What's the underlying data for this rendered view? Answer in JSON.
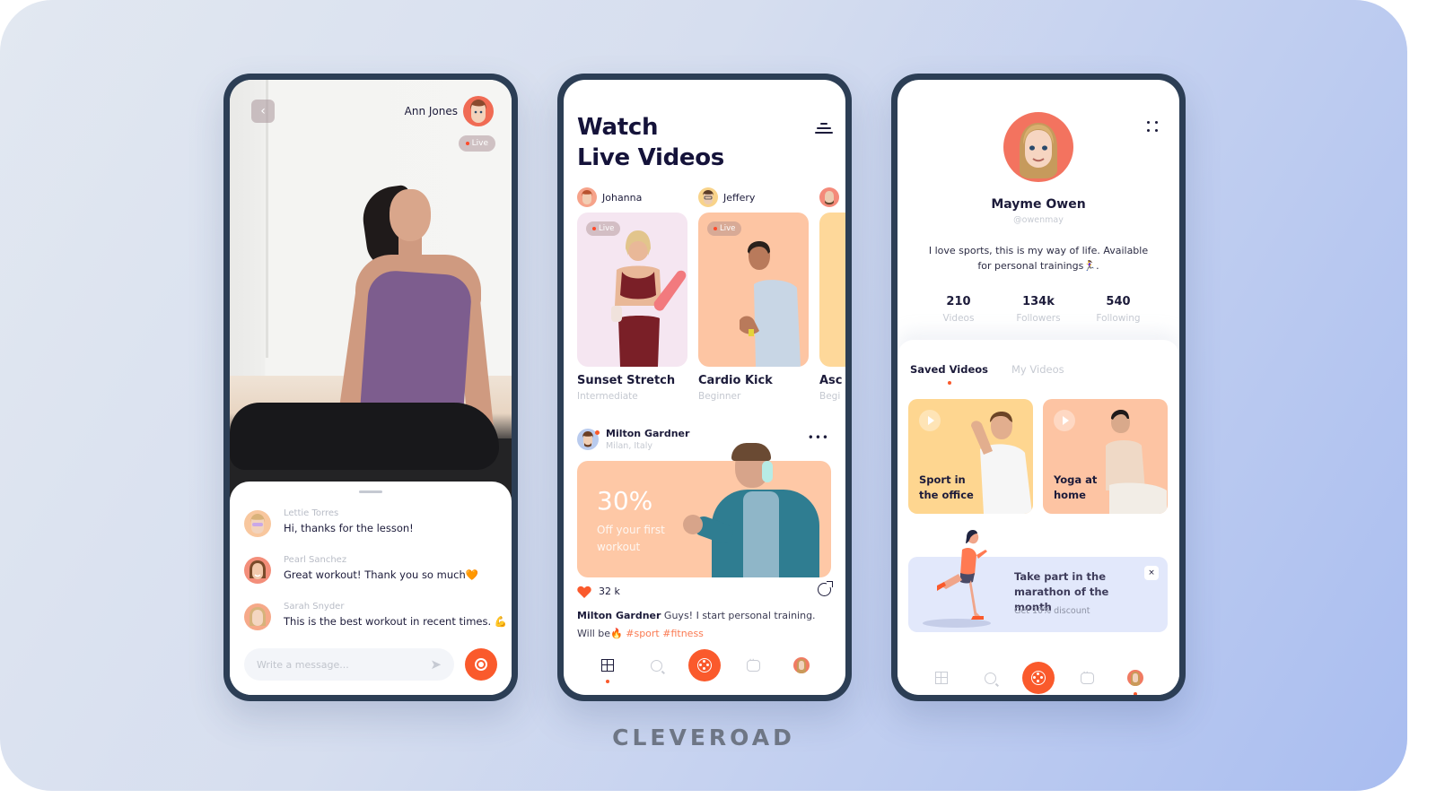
{
  "brand": "CLEVEROAD",
  "colors": {
    "accent": "#fa5a2c",
    "navy": "#1c1b3a",
    "phone_frame": "#2c3e55",
    "muted": "#c4c8d0",
    "promo_peach": "#fec8a6",
    "banner_blue": "#e2e8fb"
  },
  "live_stream": {
    "back_icon": "chevron-left-icon",
    "host_name": "Ann Jones",
    "live_label": "Live",
    "messages": [
      {
        "author": "Lettie Torres",
        "text": "Hi, thanks for the lesson!"
      },
      {
        "author": "Pearl Sanchez",
        "text": "Great workout! Thank you so much🧡"
      },
      {
        "author": "Sarah Snyder",
        "text": "This is the best workout in recent times. 💪"
      }
    ],
    "compose_placeholder": "Write a message...",
    "send_icon": "send-icon",
    "record_icon": "record-icon"
  },
  "watch": {
    "title_line1": "Watch",
    "title_line2": "Live Videos",
    "filter_icon": "filter-icon",
    "creators": [
      {
        "name": "Johanna"
      },
      {
        "name": "Jeffery"
      },
      {
        "name": ""
      }
    ],
    "videos": [
      {
        "live": "Live",
        "title": "Sunset Stretch",
        "level": "Intermediate"
      },
      {
        "live": "Live",
        "title": "Cardio Kick",
        "level": "Beginner"
      },
      {
        "live": "",
        "title": "Asc",
        "level": "Begi"
      }
    ],
    "post": {
      "author": "Milton Gardner",
      "location": "Milan, Italy",
      "promo_value": "30%",
      "promo_text": "Off your first workout",
      "likes": "32 k",
      "caption_author": "Milton Gardner",
      "caption_text": " Guys! I start personal training. Will be🔥 ",
      "hashtags": "#sport #fitness"
    }
  },
  "profile": {
    "name": "Mayme Owen",
    "handle": "@owenmay",
    "bio": "I love sports, this is my way of life. Available for personal trainings🏃‍♀️.",
    "stats": [
      {
        "value": "210",
        "label": "Videos"
      },
      {
        "value": "134k",
        "label": "Followers"
      },
      {
        "value": "540",
        "label": "Following"
      }
    ],
    "tabs": [
      {
        "label": "Saved Videos",
        "active": true
      },
      {
        "label": "My Videos",
        "active": false
      }
    ],
    "saved": [
      {
        "title": "Sport in the office"
      },
      {
        "title": "Yoga at home"
      }
    ],
    "banner": {
      "title": "Take part in the marathon of the month",
      "subtitle": "Get 10% discount",
      "close_label": "×"
    }
  },
  "tabbar": [
    {
      "name": "home",
      "icon": "grid-icon"
    },
    {
      "name": "search",
      "icon": "search-icon"
    },
    {
      "name": "live",
      "icon": "reel-icon"
    },
    {
      "name": "messages",
      "icon": "chat-icon"
    },
    {
      "name": "profile",
      "icon": "avatar"
    }
  ]
}
